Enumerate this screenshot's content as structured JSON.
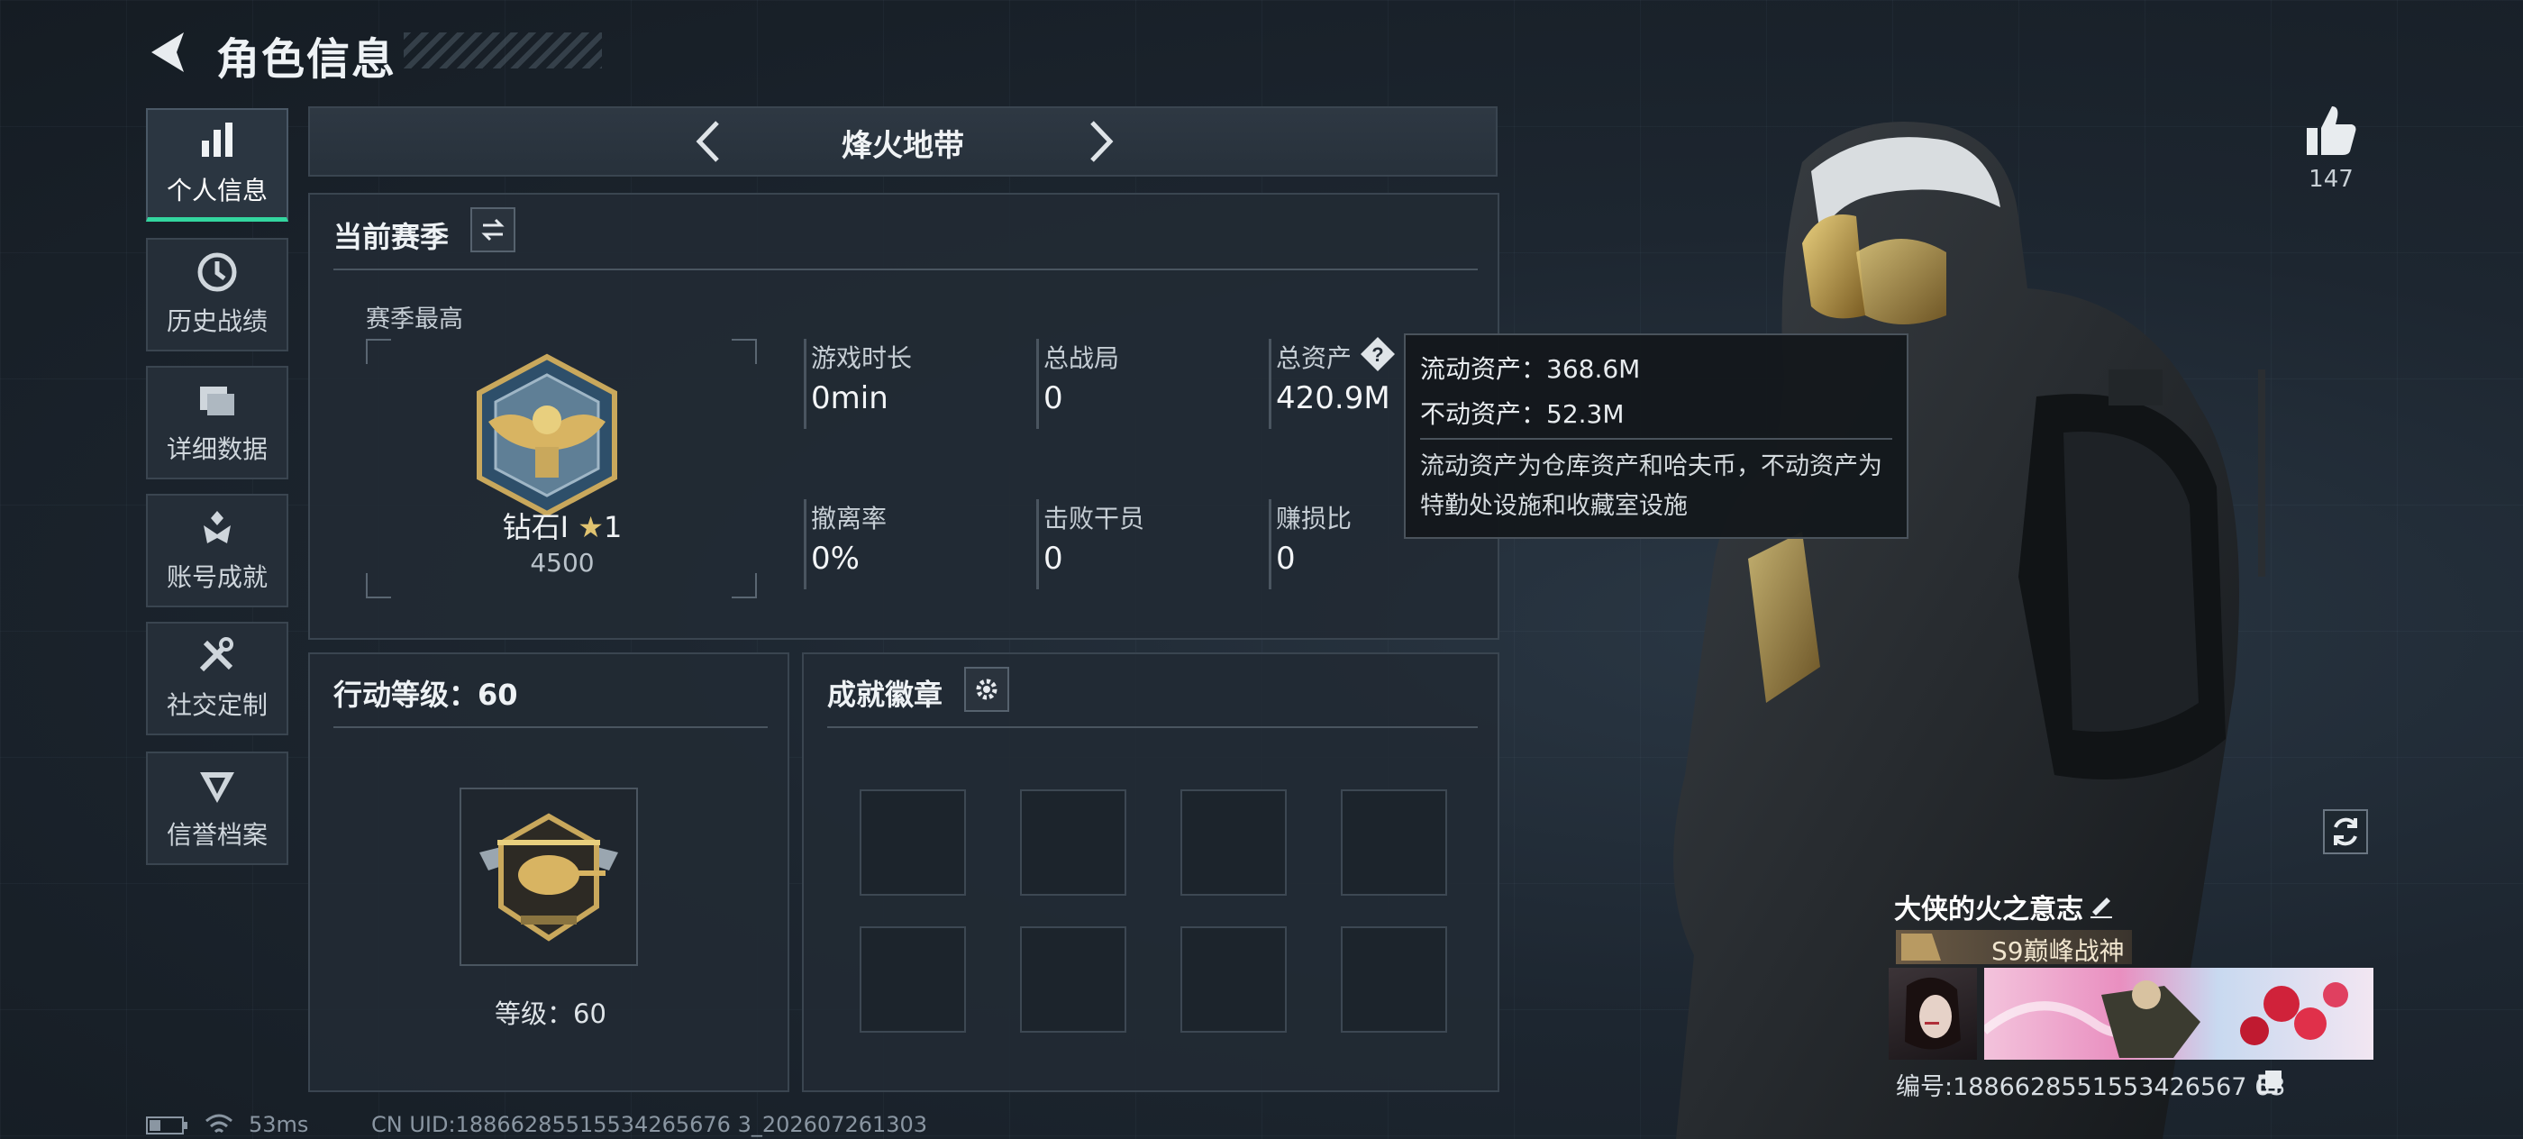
{
  "header": {
    "title": "角色信息"
  },
  "nav": [
    {
      "label": "个人信息",
      "icon": "bar-chart-icon",
      "active": true
    },
    {
      "label": "历史战绩",
      "icon": "clock-icon",
      "active": false
    },
    {
      "label": "详细数据",
      "icon": "cards-icon",
      "active": false
    },
    {
      "label": "账号成就",
      "icon": "achievement-icon",
      "active": false
    },
    {
      "label": "社交定制",
      "icon": "tools-icon",
      "active": false
    },
    {
      "label": "信誉档案",
      "icon": "shield-icon",
      "active": false
    }
  ],
  "mode": {
    "title": "烽火地带"
  },
  "season": {
    "title": "当前赛季",
    "best_label": "赛季最高",
    "rank_name": "钻石Ⅰ",
    "rank_stars": "1",
    "rank_score": "4500",
    "stats": [
      {
        "label": "游戏时长",
        "value": "0min"
      },
      {
        "label": "总战局",
        "value": "0"
      },
      {
        "label": "总资产",
        "value": "420.9M"
      },
      {
        "label": "撤离率",
        "value": "0%"
      },
      {
        "label": "击败干员",
        "value": "0"
      },
      {
        "label": "赚损比",
        "value": "0"
      }
    ]
  },
  "tooltip": {
    "line1": "流动资产：368.6M",
    "line2": "不动资产：52.3M",
    "desc": "流动资产为仓库资产和哈夫币，不动资产为特勤处设施和收藏室设施"
  },
  "action_level": {
    "title": "行动等级：60",
    "level_text": "等级：60"
  },
  "badges": {
    "title": "成就徽章"
  },
  "profile": {
    "likes": "147",
    "player_name": "大侠的火之意志",
    "title_badge": "S9巅峰战神",
    "player_id": "编号:1886628551553426567 63"
  },
  "status_bar": {
    "ping": "53ms",
    "uid": "CN UID:18866285515534265676 3_202607261303"
  },
  "colors": {
    "accent": "#33d69f",
    "panel": "#222a34",
    "background": "#1b232c"
  }
}
